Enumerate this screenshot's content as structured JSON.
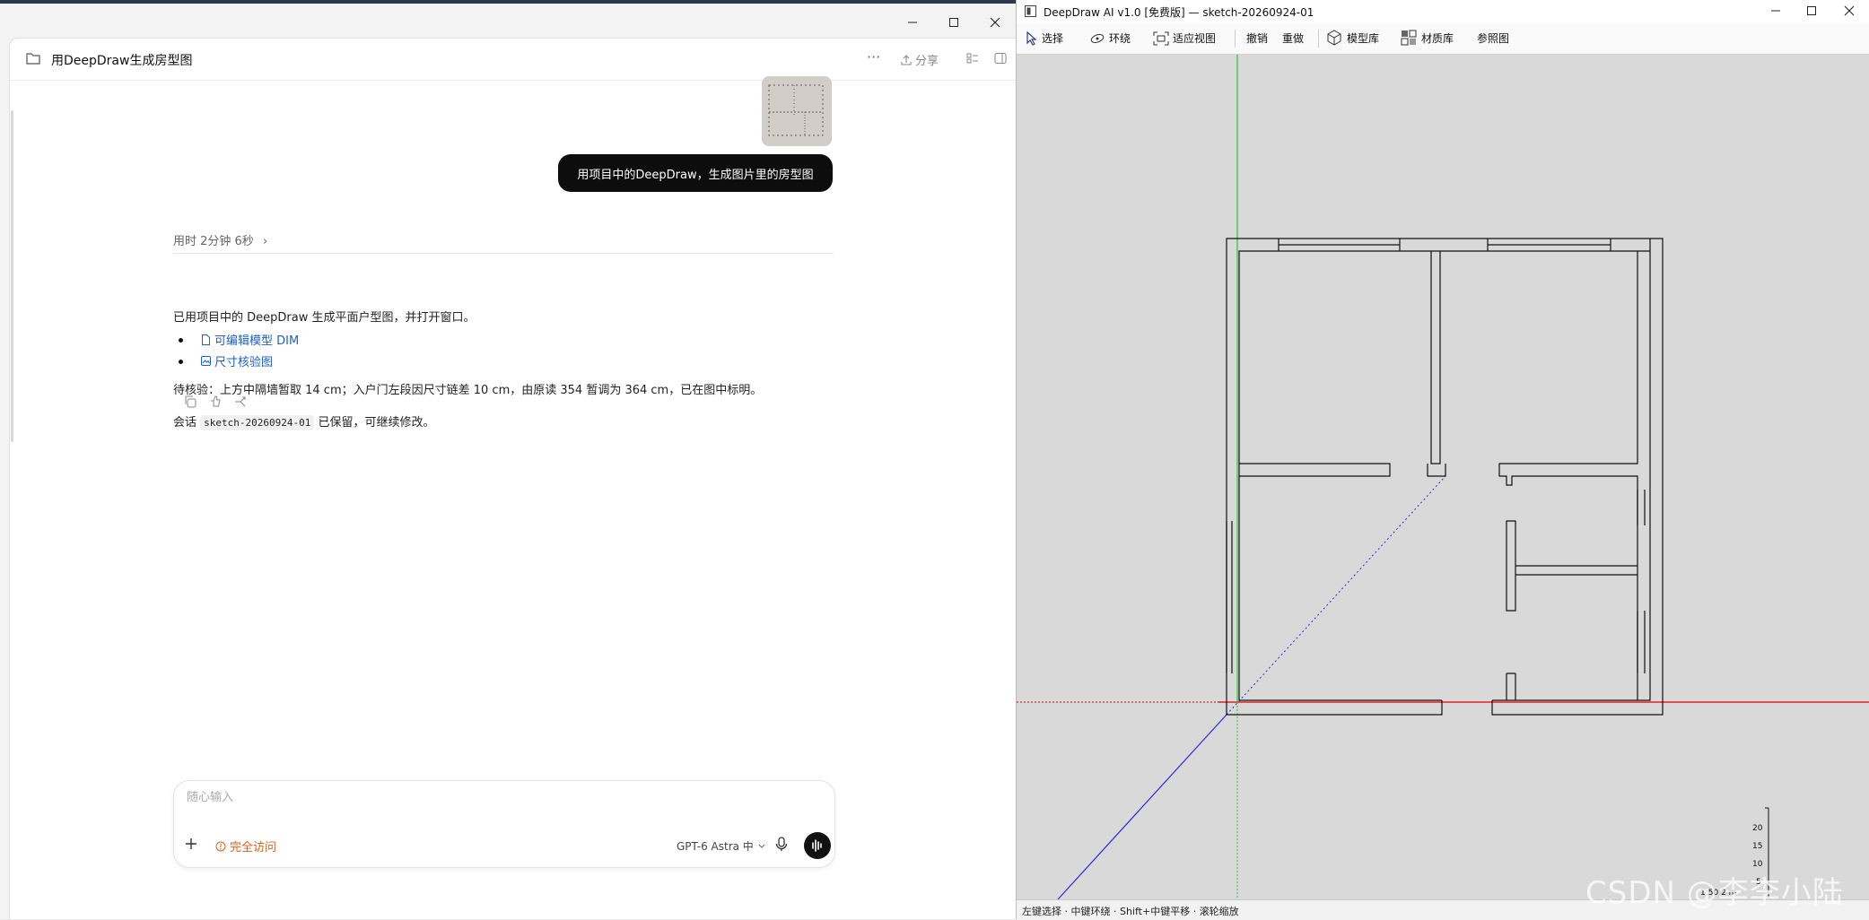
{
  "left_window": {
    "caption_buttons": [
      "minimize",
      "maximize",
      "close"
    ],
    "conversation_title": "用DeepDraw生成房型图",
    "topbar": {
      "more": "···",
      "share_label": "分享"
    },
    "user_message": "用项目中的DeepDraw，生成图片里的房型图",
    "elapsed": "用时 2分钟 6秒",
    "answer": {
      "intro": "已用项目中的 DeepDraw 生成平面户型图，并打开窗口。",
      "links": [
        "可编辑模型 DIM",
        "尺寸核验图"
      ],
      "note": "待核验：上方中隔墙暂取 14 cm；入户门左段因尺寸链差 10 cm，由原读 354 暂调为 364 cm，已在图中标明。",
      "session_prefix": "会话",
      "session_id": "sketch-20260924-01",
      "session_suffix": "已保留，可继续修改。"
    },
    "composer": {
      "placeholder": "随心输入",
      "access_label": "完全访问",
      "model_label": "GPT-6 Astra 中"
    }
  },
  "right_window": {
    "title": "DeepDraw AI v1.0 [免费版] — sketch-20260924-01",
    "toolbar": [
      "选择",
      "环绕",
      "适应视图",
      "撤销",
      "重做",
      "模型库",
      "材质库",
      "参照图"
    ],
    "status": "左键选择 · 中键环绕 · Shift+中键平移 · 滚轮缩放",
    "ruler_ticks": [
      "20",
      "15",
      "10",
      "5"
    ],
    "scale_label": "1:50  2 m"
  },
  "colors": {
    "accent_link": "#1f5fc9",
    "access_orange": "#d9601a",
    "axis_red": "#e00000",
    "axis_green": "#2cc52c",
    "axis_blue": "#2a2ae0",
    "viewport_bg": "#d9d9d9"
  },
  "watermark": "CSDN @李李小陆"
}
